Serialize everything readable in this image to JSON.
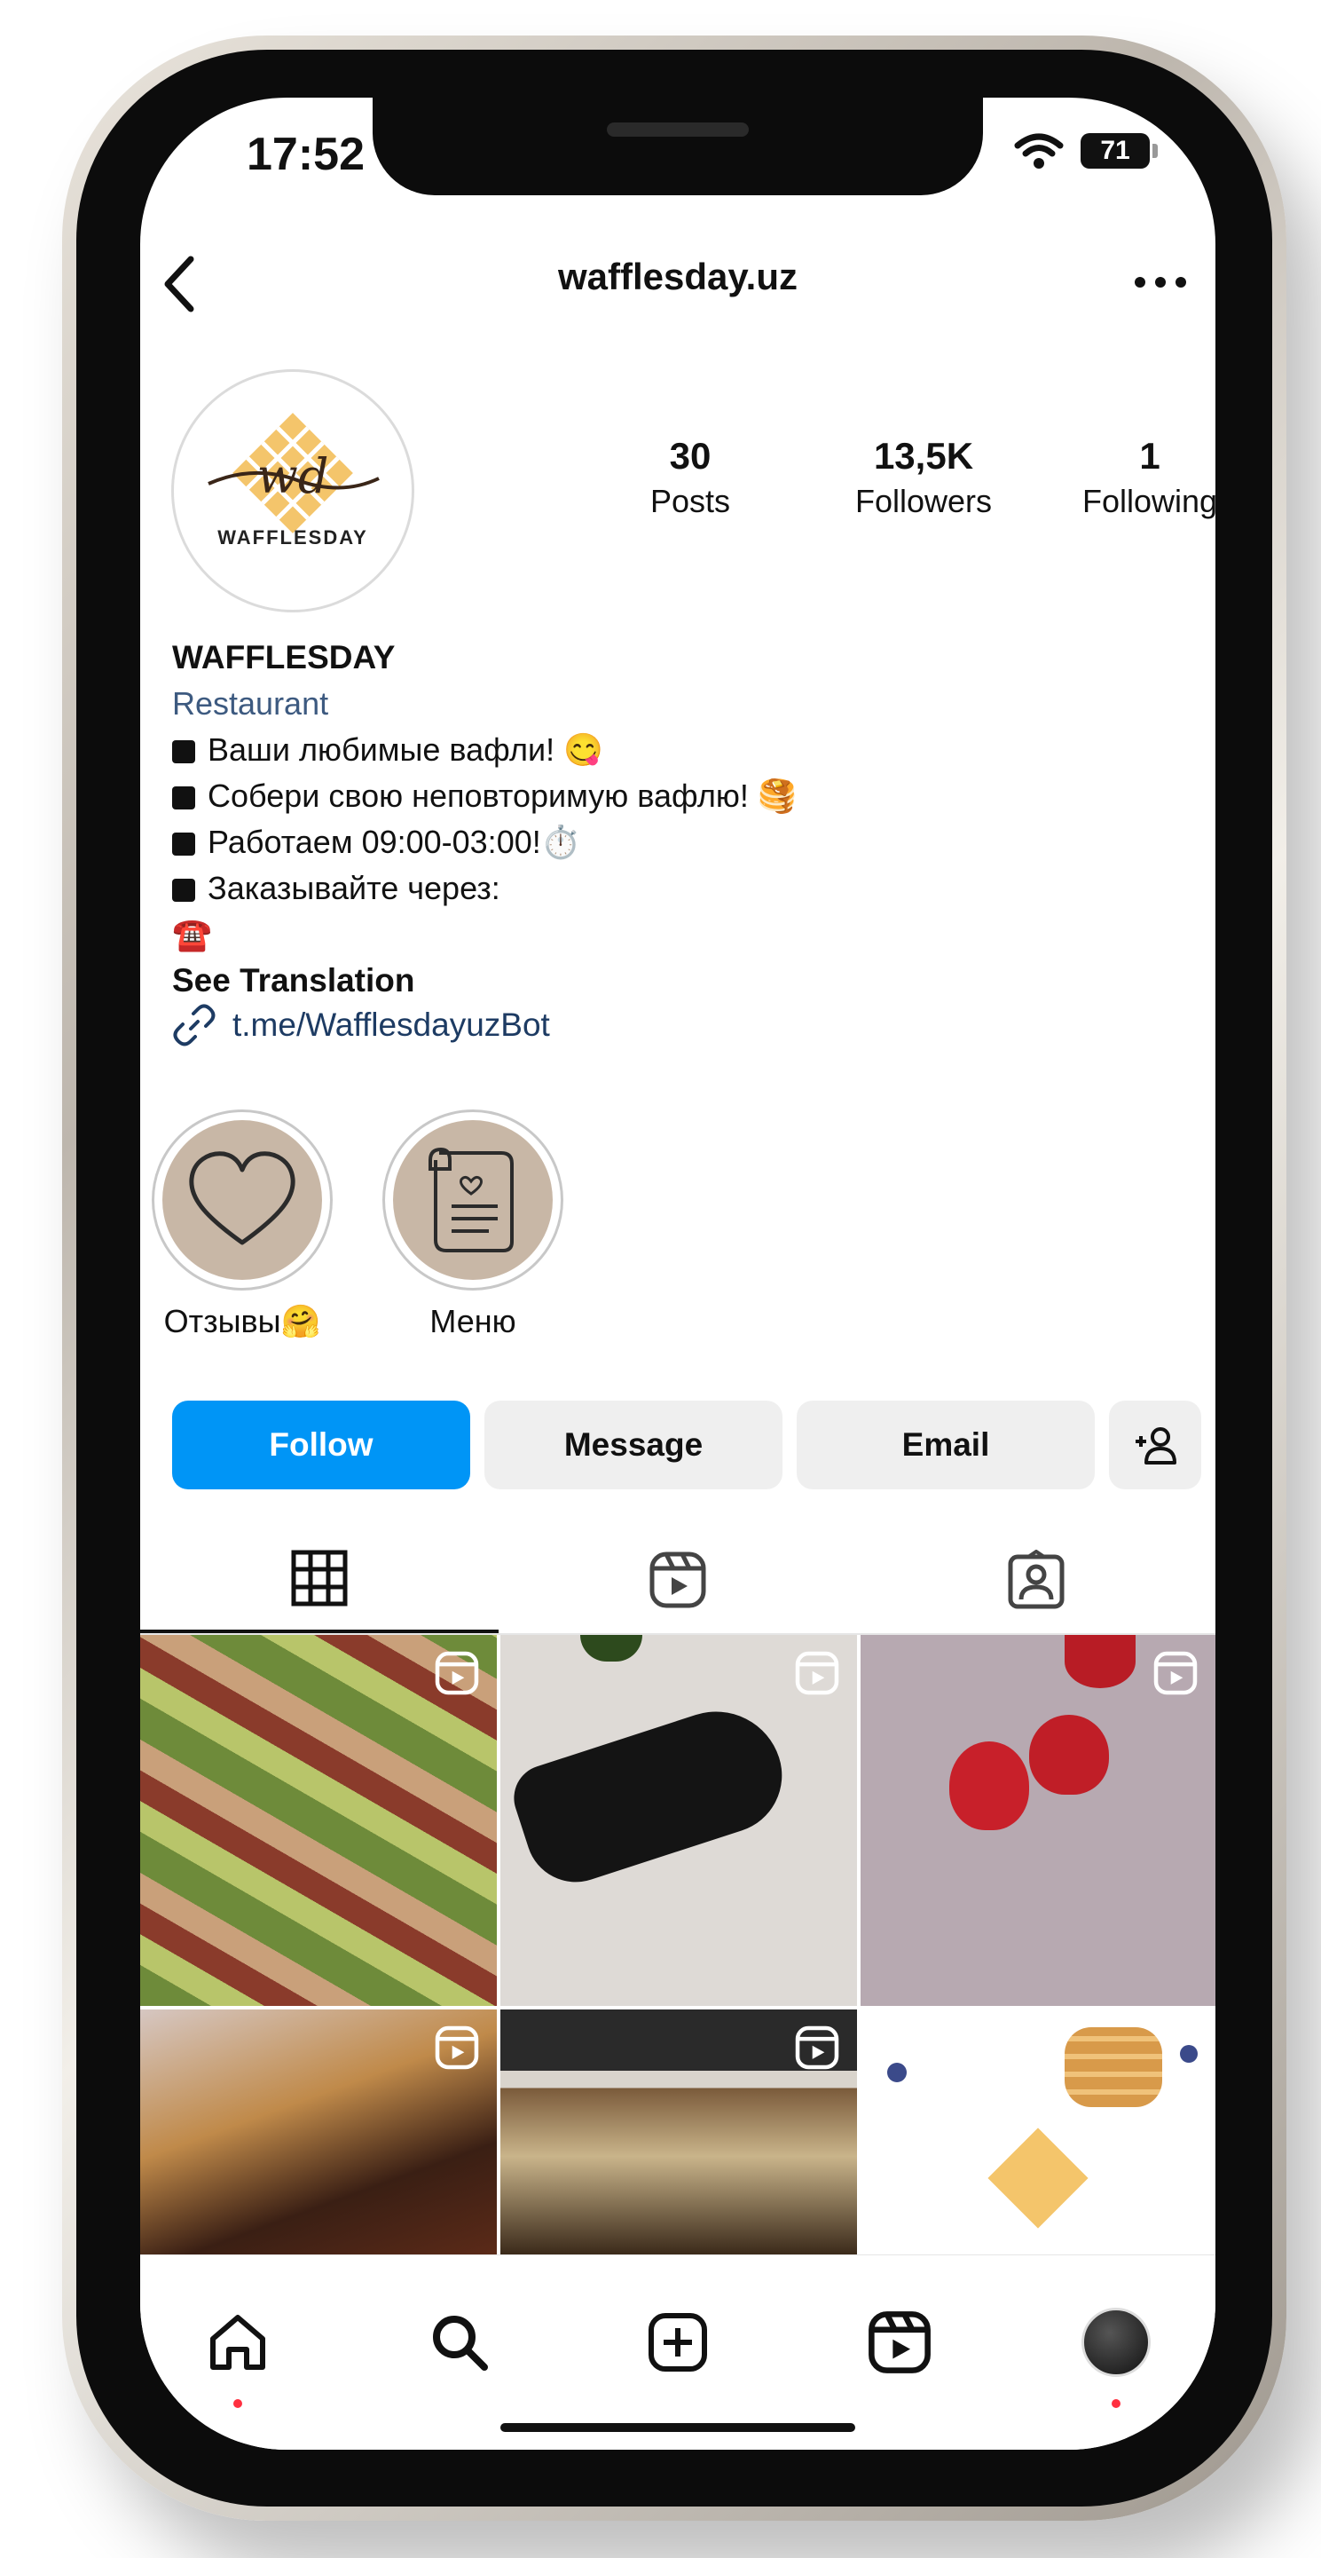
{
  "status_bar": {
    "time": "17:52",
    "battery": "71"
  },
  "nav": {
    "title": "wafflesday.uz"
  },
  "profile": {
    "logo_text": "WAFFLESDAY",
    "logo_monogram": "wd",
    "stats": [
      {
        "value": "30",
        "label": "Posts"
      },
      {
        "value": "13,5K",
        "label": "Followers"
      },
      {
        "value": "1",
        "label": "Following"
      }
    ],
    "name": "WAFFLESDAY",
    "category": "Restaurant",
    "bio_lines": [
      "Ваши любимые вафли! 😋",
      "Собери свою неповторимую вафлю! 🥞",
      "Работаем 09:00-03:00!⏱️",
      "Заказывайте через:"
    ],
    "bio_phone_emoji": "☎️",
    "see_translation": "See Translation",
    "link": "t.me/WafflesdayuzBot"
  },
  "highlights": [
    {
      "label": "Отзывы🤗",
      "icon": "heart-icon"
    },
    {
      "label": "Меню",
      "icon": "scroll-icon"
    }
  ],
  "actions": {
    "follow": "Follow",
    "message": "Message",
    "email": "Email"
  },
  "tabs": [
    "grid-icon",
    "reels-icon",
    "tagged-icon"
  ],
  "bottom_nav": [
    "home-icon",
    "search-icon",
    "create-icon",
    "reels-icon",
    "profile-avatar"
  ],
  "colors": {
    "follow_button": "#0095f6",
    "category_link": "#3d5a80",
    "notification_dot": "#ff3040"
  }
}
